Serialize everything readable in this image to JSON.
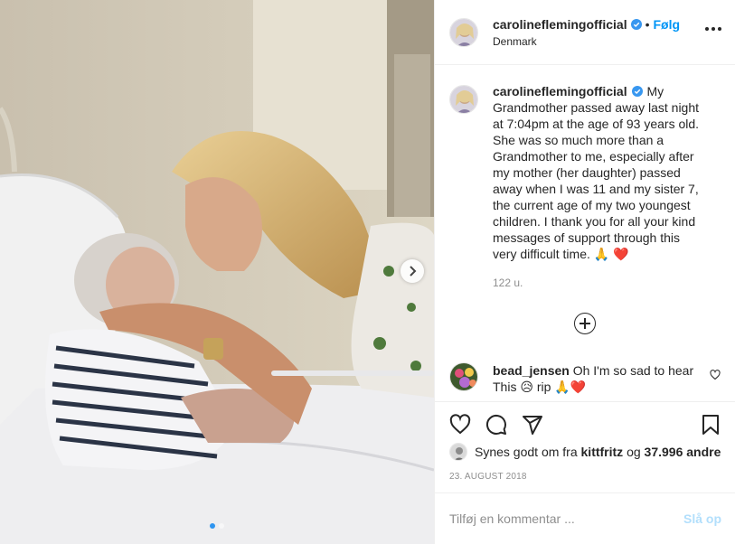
{
  "post": {
    "username": "carolineflemingofficial",
    "location": "Denmark",
    "follow_label": "Følg",
    "separator": "•",
    "caption": "My Grandmother passed away last night at 7:04pm at the age of 93 years old. She was so much more than a Grandmother to me, especially after my mother (her daughter) passed away when I was 11 and my sister 7, the current age of my two youngest children. I thank you for all your kind messages of support through this very difficult time. 🙏 ❤️",
    "caption_time": "122 u.",
    "date": "23. AUGUST 2018"
  },
  "comment": {
    "username": "bead_jensen",
    "text": "Oh I'm so sad to hear This 😥 rip 🙏❤️"
  },
  "likes": {
    "prefix": "Synes godt om fra",
    "liker": "kittfritz",
    "joiner": "og",
    "count": "37.996 andre"
  },
  "composer": {
    "placeholder": "Tilføj en kommentar ...",
    "post_label": "Slå op"
  },
  "carousel": {
    "slides": 2,
    "active": 0
  },
  "colors": {
    "accent": "#0095f6",
    "verified": "#3897f0",
    "muted": "#8e8e8e",
    "post_disabled": "#b2dffc"
  },
  "icons": [
    "verified-badge-icon",
    "more-options-icon",
    "chevron-right-icon",
    "add-circle-icon",
    "heart-icon",
    "comment-icon",
    "share-icon",
    "bookmark-icon"
  ]
}
